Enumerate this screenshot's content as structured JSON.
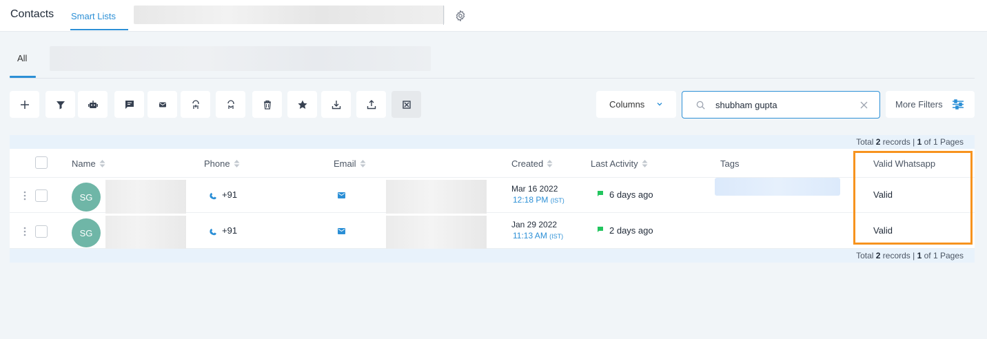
{
  "topbar": {
    "title": "Contacts",
    "tab_smart_lists": "Smart Lists",
    "settings_icon": "gear-icon"
  },
  "filter_tabs": {
    "all": "All"
  },
  "toolbar": {
    "icons": [
      "plus-icon",
      "filter-icon",
      "robot-icon",
      "message-icon",
      "mail-icon",
      "add-to-list-icon",
      "remove-from-list-icon",
      "trash-icon",
      "star-icon",
      "import-icon",
      "export-icon",
      "merge-icon"
    ],
    "columns_label": "Columns",
    "search_value": "shubham gupta",
    "more_filters_label": "More Filters"
  },
  "pager": {
    "prefix": "Total ",
    "total": "2",
    "mid": " records | ",
    "page": "1",
    "suffix": " of 1 Pages"
  },
  "table": {
    "headers": {
      "name": "Name",
      "phone": "Phone",
      "email": "Email",
      "created": "Created",
      "last_activity": "Last Activity",
      "tags": "Tags",
      "valid_whatsapp": "Valid Whatsapp"
    },
    "rows": [
      {
        "initials": "SG",
        "phone": "+91",
        "created_date": "Mar 16 2022",
        "created_time": "12:18 PM",
        "tz": "(IST)",
        "last_activity": "6 days ago",
        "valid_whatsapp": "Valid"
      },
      {
        "initials": "SG",
        "phone": "+91",
        "created_date": "Jan 29 2022",
        "created_time": "11:13 AM",
        "tz": "(IST)",
        "last_activity": "2 days ago",
        "valid_whatsapp": "Valid"
      }
    ]
  },
  "colors": {
    "accent": "#2b8fd6",
    "avatar": "#6fb6a7",
    "highlight": "#f7931e",
    "activity": "#22c55e"
  }
}
